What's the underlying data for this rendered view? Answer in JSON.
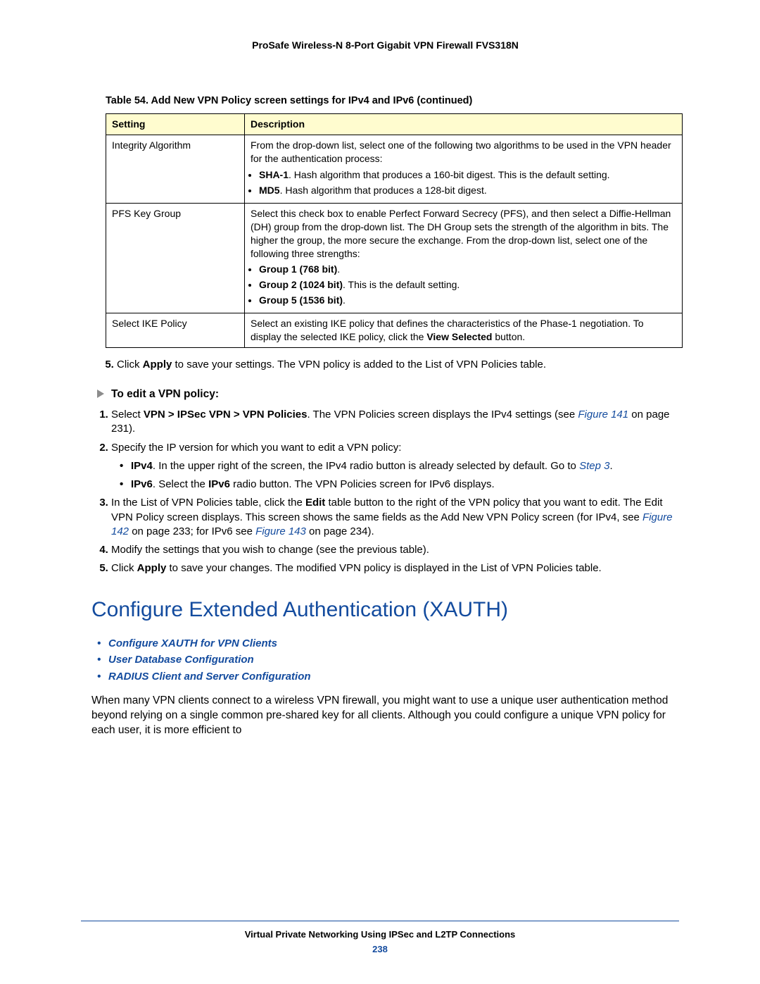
{
  "runningHead": "ProSafe Wireless-N 8-Port Gigabit VPN Firewall FVS318N",
  "tableCaption": "Table 54.  Add New VPN Policy screen settings for IPv4 and IPv6 (continued)",
  "headers": {
    "setting": "Setting",
    "description": "Description"
  },
  "rows": {
    "integrity": {
      "setting": "Integrity Algorithm",
      "intro": "From the drop-down list, select one of the following two algorithms to be used in the VPN header for the authentication process:",
      "b1_bold": "SHA-1",
      "b1_rest": ". Hash algorithm that produces a 160-bit digest. This is the default setting.",
      "b2_bold": "MD5",
      "b2_rest": ". Hash algorithm that produces a 128-bit digest."
    },
    "pfs": {
      "setting": "PFS Key Group",
      "intro": "Select this check box to enable Perfect Forward Secrecy (PFS), and then select a Diffie-Hellman (DH) group from the drop-down list. The DH Group sets the strength of the algorithm in bits. The higher the group, the more secure the exchange. From the drop-down list, select one of the following three strengths:",
      "g1": "Group 1 (768 bit)",
      "g2": "Group 2 (1024 bit)",
      "g2_rest": ". This is the default setting.",
      "g3": "Group 5 (1536 bit)"
    },
    "ike": {
      "setting": "Select IKE Policy",
      "d1": "Select an existing IKE policy that defines the characteristics of the Phase-1 negotiation. To display the selected IKE policy, click the ",
      "d1_bold": "View Selected",
      "d1_end": " button."
    }
  },
  "step5_a": "Click ",
  "step5_b": "Apply",
  "step5_c": " to save your settings. The VPN policy is added to the List of VPN Policies table.",
  "procHead": "To edit a VPN policy:",
  "edit": {
    "s1_a": "Select ",
    "s1_b": "VPN > IPSec VPN > VPN Policies",
    "s1_c": ". The VPN Policies screen displays the IPv4 settings (see ",
    "s1_link": "Figure 141",
    "s1_d": " on page 231).",
    "s2": "Specify the IP version for which you want to edit a VPN policy:",
    "s2a_b": "IPv4",
    "s2a_r": ". In the upper right of the screen, the IPv4 radio button is already selected by default. Go to ",
    "s2a_link": "Step 3",
    "s2a_dot": ".",
    "s2b_b": "IPv6",
    "s2b_r1": ". Select the ",
    "s2b_b2": "IPv6",
    "s2b_r2": " radio button. The VPN Policies screen for IPv6 displays.",
    "s3_a": "In the List of VPN Policies table, click the ",
    "s3_b": "Edit",
    "s3_c": " table button to the right of the VPN policy that you want to edit. The Edit VPN Policy screen displays. This screen shows the same fields as the Add New VPN Policy screen (for IPv4, see ",
    "s3_link1": "Figure 142",
    "s3_d": " on page 233; for IPv6 see ",
    "s3_link2": "Figure 143",
    "s3_e": " on page 234).",
    "s4": "Modify the settings that you wish to change (see the previous table).",
    "s5_a": "Click ",
    "s5_b": "Apply",
    "s5_c": " to save your changes. The modified VPN policy is displayed in the List of VPN Policies table."
  },
  "section": "Configure Extended Authentication (XAUTH)",
  "toc": {
    "i1": "Configure XAUTH for VPN Clients",
    "i2": "User Database Configuration",
    "i3": "RADIUS Client and Server Configuration"
  },
  "para": "When many VPN clients connect to a wireless VPN firewall, you might want to use a unique user authentication method beyond relying on a single common pre-shared key for all clients. Although you could configure a unique VPN policy for each user, it is more efficient to",
  "footer": {
    "chapter": "Virtual Private Networking Using IPSec and L2TP Connections",
    "page": "238"
  }
}
